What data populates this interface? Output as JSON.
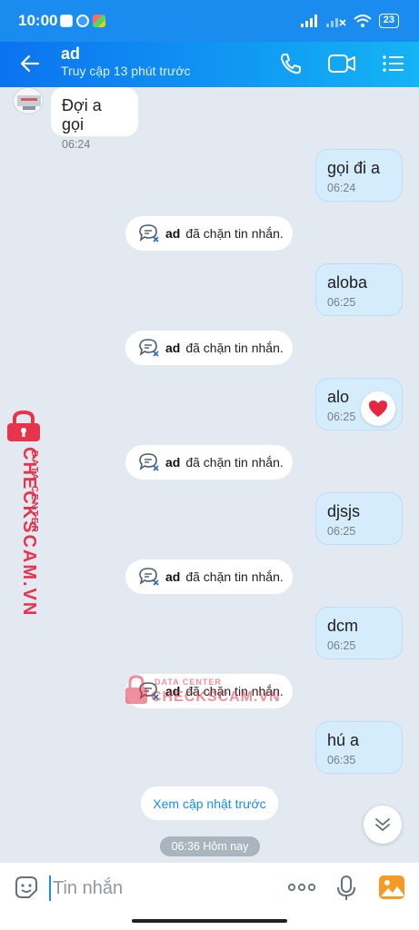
{
  "status_bar": {
    "time": "10:00",
    "battery": "23"
  },
  "header": {
    "contact_name": "ad",
    "last_seen": "Truy cập 13 phút trước"
  },
  "messages": [
    {
      "text": "Đợi a gọi",
      "time": "06:24"
    },
    {
      "text": "gọi đi a",
      "time": "06:24"
    },
    {
      "text": "aloba",
      "time": "06:25"
    },
    {
      "text": "alo",
      "time": "06:25"
    },
    {
      "text": "djsjs",
      "time": "06:25"
    },
    {
      "text": "dcm",
      "time": "06:25"
    },
    {
      "text": "hú a",
      "time": "06:35"
    }
  ],
  "system_notice": {
    "who": "ad",
    "what": "đã chặn tin nhắn."
  },
  "update_link": "Xem cập nhật trước",
  "date_separator": "06:36 Hôm nay",
  "composer": {
    "placeholder": "Tin nhắn"
  },
  "watermark": {
    "brand": "CHECKSCAM.VN",
    "caption": "DATA CENTER"
  },
  "colors": {
    "accent": "#1a8cf0",
    "outgoing_bubble": "#d4ecfb",
    "background": "#e2e9f1",
    "watermark": "#e6344d"
  },
  "icons": [
    "back-arrow-icon",
    "phone-icon",
    "video-call-icon",
    "list-menu-icon",
    "blocked-chat-icon",
    "heart-reaction-icon",
    "chevron-down-icon",
    "sticker-icon",
    "more-icon",
    "microphone-icon",
    "image-icon"
  ]
}
